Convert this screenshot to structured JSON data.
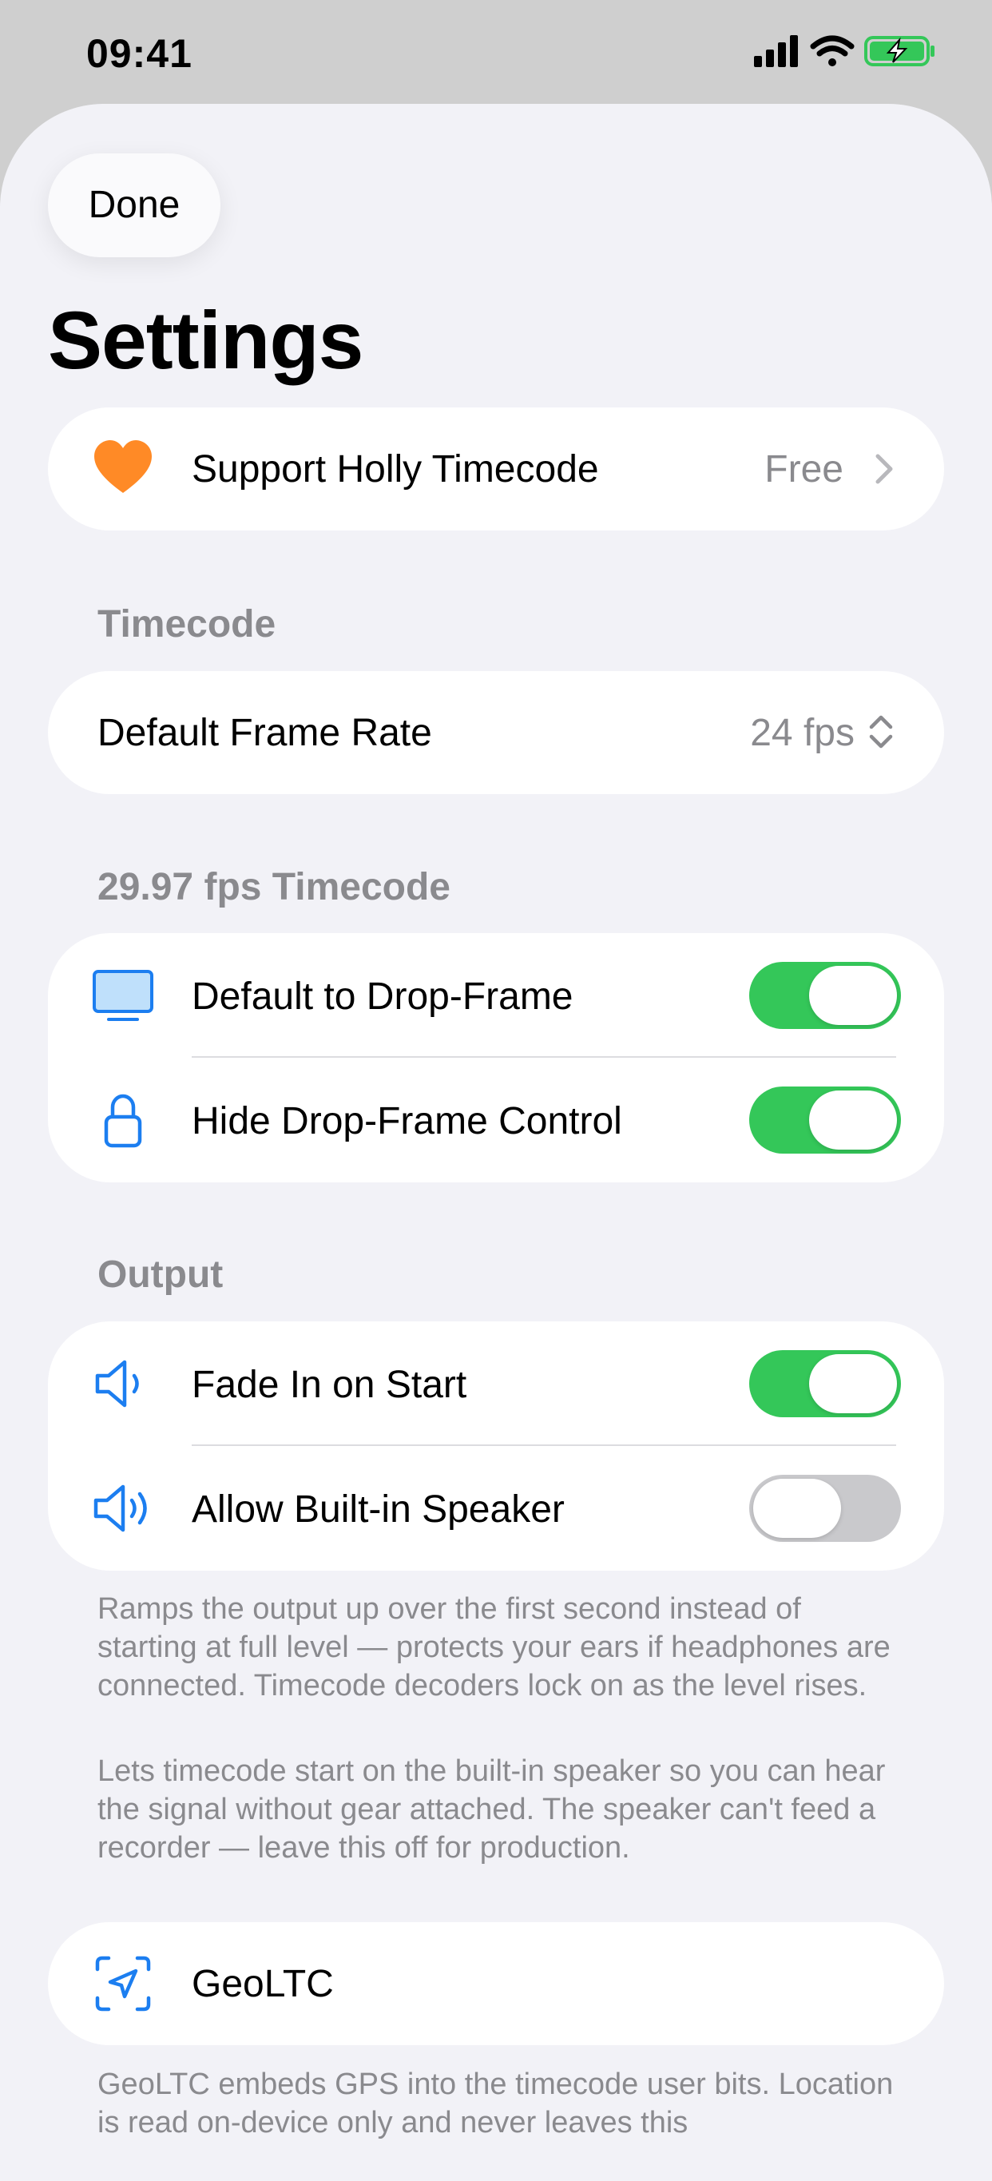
{
  "status_bar": {
    "time": "09:41"
  },
  "header": {
    "done_label": "Done",
    "title": "Settings"
  },
  "support": {
    "label": "Support Holly Timecode",
    "value": "Free"
  },
  "timecode_section": {
    "header": "Timecode",
    "frame_rate_label": "Default Frame Rate",
    "frame_rate_value": "24 fps"
  },
  "drop_frame_section": {
    "header": "29.97 fps Timecode",
    "items": [
      {
        "label": "Default to Drop-Frame",
        "icon": "display-icon",
        "on": true
      },
      {
        "label": "Hide Drop-Frame Control",
        "icon": "lock-icon",
        "on": true
      }
    ]
  },
  "output_section": {
    "header": "Output",
    "items": [
      {
        "label": "Fade In on Start",
        "icon": "speaker-low-icon",
        "on": true
      },
      {
        "label": "Allow Built-in Speaker",
        "icon": "speaker-high-icon",
        "on": false
      }
    ],
    "footnote_1": "Ramps the output up over the first second instead of starting at full level — protects your ears if headphones are connected. Timecode decoders lock on as the level rises.",
    "footnote_2": "Lets timecode start on the built-in speaker so you can hear the signal without gear attached. The speaker can't feed a recorder — leave this off for production."
  },
  "geoltc": {
    "label": "GeoLTC",
    "footnote": "GeoLTC embeds GPS into the timecode user bits. Location is read on-device only and never leaves this"
  },
  "colors": {
    "accent": "#1c7ef0",
    "toggle_on": "#34c759",
    "toggle_off": "#c9c9cc",
    "heart": "#ff8a26",
    "secondary_text": "#8a8a8e",
    "background": "#f2f2f7"
  }
}
